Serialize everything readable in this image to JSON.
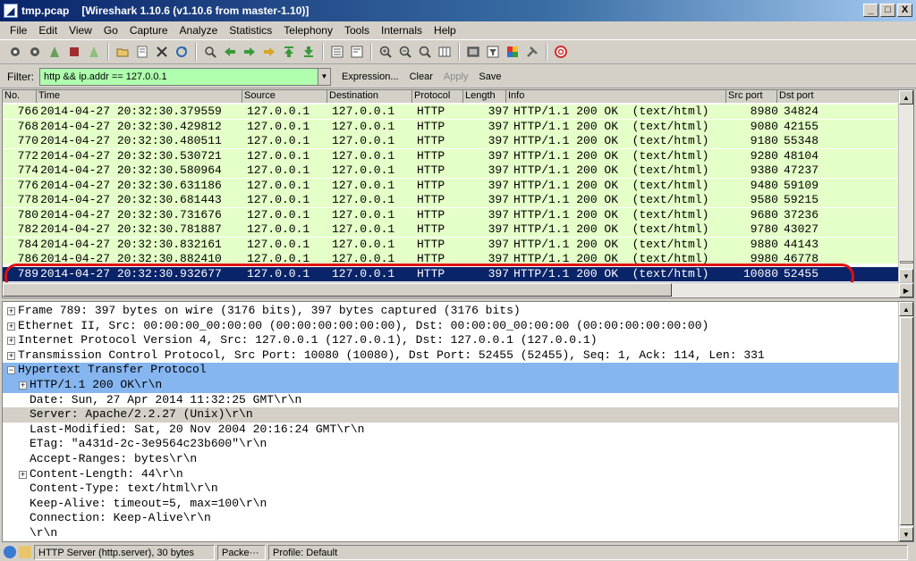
{
  "window": {
    "file_name": "tmp.pcap",
    "app_title": "[Wireshark 1.10.6  (v1.10.6 from master-1.10)]",
    "minimize": "_",
    "maximize": "□",
    "close": "X"
  },
  "menu": [
    "File",
    "Edit",
    "View",
    "Go",
    "Capture",
    "Analyze",
    "Statistics",
    "Telephony",
    "Tools",
    "Internals",
    "Help"
  ],
  "toolbar_icons": [
    "interface-list-icon",
    "capture-options-icon",
    "start-capture-icon",
    "stop-capture-icon",
    "restart-capture-icon",
    "open-file-icon",
    "save-file-icon",
    "close-file-icon",
    "reload-icon",
    "find-packet-icon",
    "go-back-icon",
    "go-forward-icon",
    "go-to-packet-icon",
    "go-first-icon",
    "go-last-icon",
    "colorize-icon",
    "autoscroll-icon",
    "zoom-in-icon",
    "zoom-out-icon",
    "zoom-normal-icon",
    "resize-columns-icon",
    "capture-filters-icon",
    "display-filters-icon",
    "coloring-rules-icon",
    "preferences-icon",
    "help-icon"
  ],
  "filter": {
    "label": "Filter:",
    "value": "http && ip.addr == 127.0.0.1",
    "expression": "Expression...",
    "clear": "Clear",
    "apply": "Apply",
    "save": "Save",
    "valid_color": "#afffaf"
  },
  "packet_list": {
    "columns": [
      "No.",
      "Time",
      "Source",
      "Destination",
      "Protocol",
      "Length",
      "Info",
      "Src port",
      "Dst port"
    ],
    "row_color": "#e4ffc7",
    "selected_color": "#0a246a",
    "rows": [
      {
        "no": "766",
        "time": "2014-04-27 20:32:30.379559",
        "src": "127.0.0.1",
        "dst": "127.0.0.1",
        "proto": "HTTP",
        "len": "397",
        "info": "HTTP/1.1 200 OK  (text/html)",
        "sport": "8980",
        "dport": "34824"
      },
      {
        "no": "768",
        "time": "2014-04-27 20:32:30.429812",
        "src": "127.0.0.1",
        "dst": "127.0.0.1",
        "proto": "HTTP",
        "len": "397",
        "info": "HTTP/1.1 200 OK  (text/html)",
        "sport": "9080",
        "dport": "42155"
      },
      {
        "no": "770",
        "time": "2014-04-27 20:32:30.480511",
        "src": "127.0.0.1",
        "dst": "127.0.0.1",
        "proto": "HTTP",
        "len": "397",
        "info": "HTTP/1.1 200 OK  (text/html)",
        "sport": "9180",
        "dport": "55348"
      },
      {
        "no": "772",
        "time": "2014-04-27 20:32:30.530721",
        "src": "127.0.0.1",
        "dst": "127.0.0.1",
        "proto": "HTTP",
        "len": "397",
        "info": "HTTP/1.1 200 OK  (text/html)",
        "sport": "9280",
        "dport": "48104"
      },
      {
        "no": "774",
        "time": "2014-04-27 20:32:30.580964",
        "src": "127.0.0.1",
        "dst": "127.0.0.1",
        "proto": "HTTP",
        "len": "397",
        "info": "HTTP/1.1 200 OK  (text/html)",
        "sport": "9380",
        "dport": "47237"
      },
      {
        "no": "776",
        "time": "2014-04-27 20:32:30.631186",
        "src": "127.0.0.1",
        "dst": "127.0.0.1",
        "proto": "HTTP",
        "len": "397",
        "info": "HTTP/1.1 200 OK  (text/html)",
        "sport": "9480",
        "dport": "59109"
      },
      {
        "no": "778",
        "time": "2014-04-27 20:32:30.681443",
        "src": "127.0.0.1",
        "dst": "127.0.0.1",
        "proto": "HTTP",
        "len": "397",
        "info": "HTTP/1.1 200 OK  (text/html)",
        "sport": "9580",
        "dport": "59215"
      },
      {
        "no": "780",
        "time": "2014-04-27 20:32:30.731676",
        "src": "127.0.0.1",
        "dst": "127.0.0.1",
        "proto": "HTTP",
        "len": "397",
        "info": "HTTP/1.1 200 OK  (text/html)",
        "sport": "9680",
        "dport": "37236"
      },
      {
        "no": "782",
        "time": "2014-04-27 20:32:30.781887",
        "src": "127.0.0.1",
        "dst": "127.0.0.1",
        "proto": "HTTP",
        "len": "397",
        "info": "HTTP/1.1 200 OK  (text/html)",
        "sport": "9780",
        "dport": "43027"
      },
      {
        "no": "784",
        "time": "2014-04-27 20:32:30.832161",
        "src": "127.0.0.1",
        "dst": "127.0.0.1",
        "proto": "HTTP",
        "len": "397",
        "info": "HTTP/1.1 200 OK  (text/html)",
        "sport": "9880",
        "dport": "44143"
      },
      {
        "no": "786",
        "time": "2014-04-27 20:32:30.882410",
        "src": "127.0.0.1",
        "dst": "127.0.0.1",
        "proto": "HTTP",
        "len": "397",
        "info": "HTTP/1.1 200 OK  (text/html)",
        "sport": "9980",
        "dport": "46778"
      },
      {
        "no": "789",
        "time": "2014-04-27 20:32:30.932677",
        "src": "127.0.0.1",
        "dst": "127.0.0.1",
        "proto": "HTTP",
        "len": "397",
        "info": "HTTP/1.1 200 OK  (text/html)",
        "sport": "10080",
        "dport": "52455",
        "selected": true
      }
    ]
  },
  "details": [
    {
      "expander": "+",
      "text": "Frame 789: 397 bytes on wire (3176 bits), 397 bytes captured (3176 bits)",
      "indent": 0
    },
    {
      "expander": "+",
      "text": "Ethernet II, Src: 00:00:00_00:00:00 (00:00:00:00:00:00), Dst: 00:00:00_00:00:00 (00:00:00:00:00:00)",
      "indent": 0
    },
    {
      "expander": "+",
      "text": "Internet Protocol Version 4, Src: 127.0.0.1 (127.0.0.1), Dst: 127.0.0.1 (127.0.0.1)",
      "indent": 0
    },
    {
      "expander": "+",
      "text": "Transmission Control Protocol, Src Port: 10080 (10080), Dst Port: 52455 (52455), Seq: 1, Ack: 114, Len: 331",
      "indent": 0
    },
    {
      "expander": "−",
      "text": "Hypertext Transfer Protocol",
      "indent": 0,
      "highlight": "blue"
    },
    {
      "expander": "+",
      "text": "HTTP/1.1 200 OK\\r\\n",
      "indent": 1,
      "highlight": "blue"
    },
    {
      "expander": "",
      "text": "Date: Sun, 27 Apr 2014 11:32:25 GMT\\r\\n",
      "indent": 1
    },
    {
      "expander": "",
      "text": "Server: Apache/2.2.27 (Unix)\\r\\n",
      "indent": 1,
      "highlight": "grey"
    },
    {
      "expander": "",
      "text": "Last-Modified: Sat, 20 Nov 2004 20:16:24 GMT\\r\\n",
      "indent": 1
    },
    {
      "expander": "",
      "text": "ETag: \"a431d-2c-3e9564c23b600\"\\r\\n",
      "indent": 1
    },
    {
      "expander": "",
      "text": "Accept-Ranges: bytes\\r\\n",
      "indent": 1
    },
    {
      "expander": "+",
      "text": "Content-Length: 44\\r\\n",
      "indent": 1
    },
    {
      "expander": "",
      "text": "Content-Type: text/html\\r\\n",
      "indent": 1
    },
    {
      "expander": "",
      "text": "Keep-Alive: timeout=5, max=100\\r\\n",
      "indent": 1
    },
    {
      "expander": "",
      "text": "Connection: Keep-Alive\\r\\n",
      "indent": 1
    },
    {
      "expander": "",
      "text": "\\r\\n",
      "indent": 1
    }
  ],
  "status": {
    "field": "HTTP Server (http.server), 30 bytes",
    "packets": "Packe···",
    "profile": "Profile: Default"
  }
}
